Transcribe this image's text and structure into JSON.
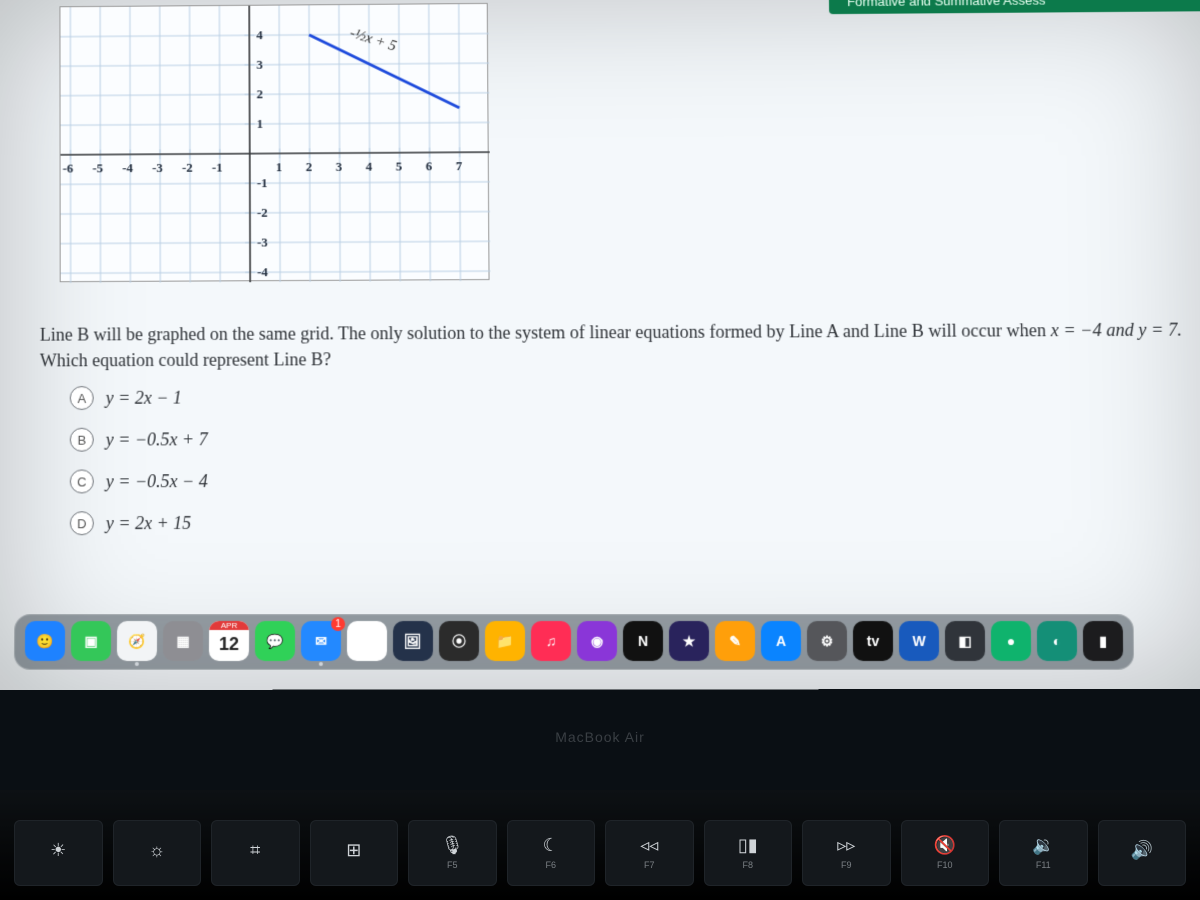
{
  "banner": {
    "text": "Formative and Summative Assess"
  },
  "chart_data": {
    "type": "line",
    "title": "",
    "xlabel": "",
    "ylabel": "",
    "xlim": [
      -6,
      7
    ],
    "ylim": [
      -4,
      4
    ],
    "x_ticks": [
      -6,
      -5,
      -4,
      -3,
      -2,
      -1,
      1,
      2,
      3,
      4,
      5,
      6,
      7
    ],
    "y_ticks": [
      -4,
      -3,
      -2,
      -1,
      1,
      2,
      3,
      4
    ],
    "series": [
      {
        "name": "Line A",
        "label": "-½x + 5",
        "points_xy": [
          [
            2,
            4
          ],
          [
            7,
            1.5
          ]
        ],
        "color": "#1e4bdc"
      }
    ],
    "grid": true
  },
  "question": {
    "lead": "Line B will be graphed on the same grid. The only solution to the system of linear equations formed by Line A and Line B will occur when",
    "cond": "x = −4 and y = 7.",
    "tail": "Which equation could represent Line B?"
  },
  "choices": [
    {
      "letter": "A",
      "text": "y = 2x − 1"
    },
    {
      "letter": "B",
      "text": "y = −0.5x + 7"
    },
    {
      "letter": "C",
      "text": "y = −0.5x − 4"
    },
    {
      "letter": "D",
      "text": "y = 2x + 15"
    }
  ],
  "dock": {
    "calendar": {
      "month": "APR",
      "day": "12"
    },
    "apps": [
      {
        "name": "finder",
        "glyph": "🙂",
        "bg": "#1e82ff",
        "dot": false
      },
      {
        "name": "facetime",
        "glyph": "▣",
        "bg": "#34c759",
        "dot": false
      },
      {
        "name": "safari",
        "glyph": "🧭",
        "bg": "#f2f4f6",
        "dot": true
      },
      {
        "name": "launchpad",
        "glyph": "▦",
        "bg": "#8e8e93",
        "dot": false
      },
      {
        "name": "calendar",
        "glyph": "",
        "bg": "",
        "dot": false
      },
      {
        "name": "messages",
        "glyph": "💬",
        "bg": "#30d158",
        "dot": false
      },
      {
        "name": "mail",
        "glyph": "✉︎",
        "bg": "#2389ff",
        "dot": true,
        "badge": "1"
      },
      {
        "name": "photos",
        "glyph": "✿",
        "bg": "#ffffff",
        "dot": false
      },
      {
        "name": "preview",
        "glyph": "🖼",
        "bg": "#24324a",
        "dot": false
      },
      {
        "name": "colors",
        "glyph": "⦿",
        "bg": "#2b2b2b",
        "dot": false
      },
      {
        "name": "files",
        "glyph": "📁",
        "bg": "#ffb300",
        "dot": false
      },
      {
        "name": "music",
        "glyph": "♫",
        "bg": "#ff2d55",
        "dot": false
      },
      {
        "name": "podcast",
        "glyph": "◉",
        "bg": "#8a36d8",
        "dot": false
      },
      {
        "name": "netflix",
        "glyph": "N",
        "bg": "#111",
        "dot": false
      },
      {
        "name": "imovie",
        "glyph": "★",
        "bg": "#29235c",
        "dot": false
      },
      {
        "name": "drawing",
        "glyph": "✎",
        "bg": "#ff9f0a",
        "dot": false
      },
      {
        "name": "appstore",
        "glyph": "A",
        "bg": "#0a84ff",
        "dot": false
      },
      {
        "name": "settings",
        "glyph": "⚙︎",
        "bg": "#55565a",
        "dot": false
      },
      {
        "name": "appletv",
        "glyph": "tv",
        "bg": "#111",
        "dot": false
      },
      {
        "name": "word",
        "glyph": "W",
        "bg": "#185abd",
        "dot": false
      },
      {
        "name": "misc1",
        "glyph": "◧",
        "bg": "#30343a",
        "dot": false
      },
      {
        "name": "chat",
        "glyph": "●",
        "bg": "#0fb36d",
        "dot": false
      },
      {
        "name": "edge",
        "glyph": "◐",
        "bg": "#148f77",
        "dot": false
      },
      {
        "name": "term",
        "glyph": "▮",
        "bg": "#1c1c1e",
        "dot": false
      }
    ]
  },
  "hardware": {
    "model": "MacBook Air",
    "fnkeys": [
      {
        "icon": "☀︎",
        "label": ""
      },
      {
        "icon": "☼",
        "label": ""
      },
      {
        "icon": "⌗",
        "label": ""
      },
      {
        "icon": "⊞",
        "label": ""
      },
      {
        "icon": "🎙",
        "label": "F5"
      },
      {
        "icon": "☾",
        "label": "F6"
      },
      {
        "icon": "◃◃",
        "label": "F7"
      },
      {
        "icon": "▯▮",
        "label": "F8"
      },
      {
        "icon": "▹▹",
        "label": "F9"
      },
      {
        "icon": "🔇",
        "label": "F10"
      },
      {
        "icon": "🔉",
        "label": "F11"
      },
      {
        "icon": "🔊",
        "label": ""
      }
    ]
  }
}
